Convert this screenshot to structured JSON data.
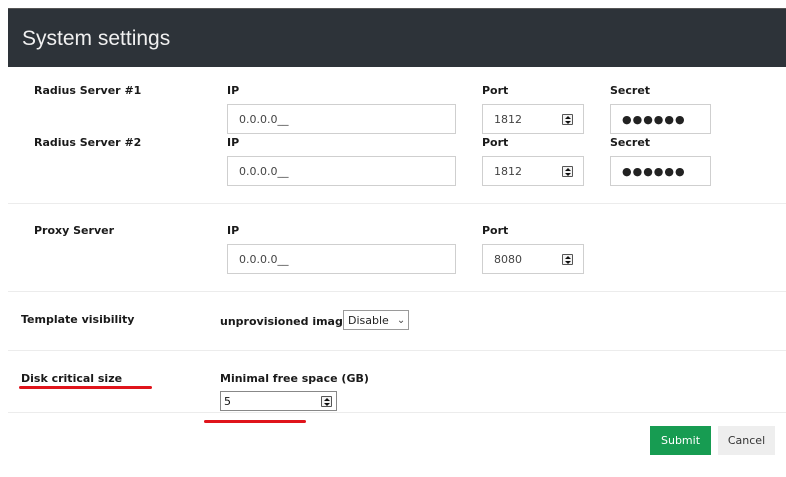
{
  "header": {
    "title": "System settings"
  },
  "radius1": {
    "label": "Radius Server #1",
    "ip_label": "IP",
    "ip_value": "0.0.0.0__",
    "port_label": "Port",
    "port_value": "1812",
    "secret_label": "Secret",
    "secret_value": "●●●●●●"
  },
  "radius2": {
    "label": "Radius Server #2",
    "ip_label": "IP",
    "ip_value": "0.0.0.0__",
    "port_label": "Port",
    "port_value": "1812",
    "secret_label": "Secret",
    "secret_value": "●●●●●●"
  },
  "proxy": {
    "label": "Proxy Server",
    "ip_label": "IP",
    "ip_value": "0.0.0.0__",
    "port_label": "Port",
    "port_value": "8080"
  },
  "template": {
    "label": "Template visibility",
    "option_label": "unprovisioned images",
    "select_value": "Disable"
  },
  "disk": {
    "label": "Disk critical size",
    "field_label": "Minimal free space (GB)",
    "value": "5"
  },
  "actions": {
    "submit_label": "Submit",
    "cancel_label": "Cancel"
  },
  "colors": {
    "header_bg": "#2d3339",
    "submit_bg": "#179c52",
    "annotation_red": "#e0141b"
  }
}
